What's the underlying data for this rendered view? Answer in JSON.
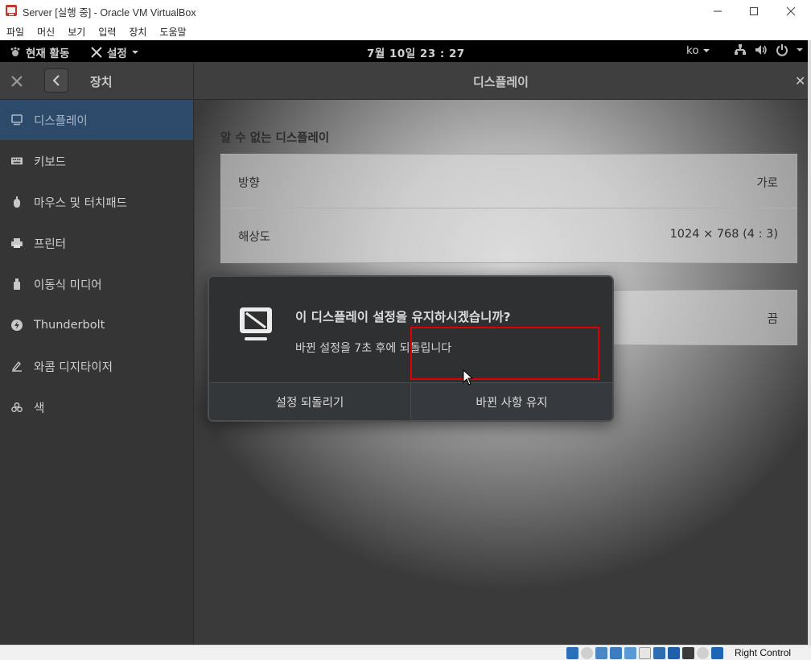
{
  "host_window": {
    "title": "Server [실행 중] - Oracle VM VirtualBox",
    "menu": [
      "파일",
      "머신",
      "보기",
      "입력",
      "장치",
      "도움말"
    ]
  },
  "topbar": {
    "activities": "현재 활동",
    "app_menu": "설정",
    "clock": "7월 10일  23 : 27",
    "language": "ko"
  },
  "header": {
    "panel_title": "장치",
    "main_title": "디스플레이"
  },
  "sidebar": {
    "items": [
      {
        "label": "디스플레이",
        "icon": "display-icon",
        "active": true
      },
      {
        "label": "키보드",
        "icon": "keyboard-icon"
      },
      {
        "label": "마우스 및 터치패드",
        "icon": "mouse-icon"
      },
      {
        "label": "프린터",
        "icon": "printer-icon"
      },
      {
        "label": "이동식 미디어",
        "icon": "removable-media-icon"
      },
      {
        "label": "Thunderbolt",
        "icon": "thunderbolt-icon"
      },
      {
        "label": "와콤 디지타이저",
        "icon": "wacom-tablet-icon"
      },
      {
        "label": "색",
        "icon": "color-icon"
      }
    ]
  },
  "display": {
    "section_title": "알 수 없는 디스플레이",
    "orientation_label": "방향",
    "orientation_value": "가로",
    "resolution_label": "해상도",
    "resolution_value": "1024 × 768 (4 : 3)",
    "night_light_value": "끔"
  },
  "dialog": {
    "title": "이 디스플레이 설정을 유지하시겠습니까?",
    "body": "바뀐 설정을 7초 후에 되돌립니다",
    "revert_label": "설정 되돌리기",
    "keep_label": "바뀐 사항 유지"
  },
  "statusbar": {
    "host_key": "Right Control"
  },
  "colors": {
    "accent_selected": "#2e4a6b",
    "highlight_box": "#e00000",
    "topbar_bg": "#000000"
  }
}
